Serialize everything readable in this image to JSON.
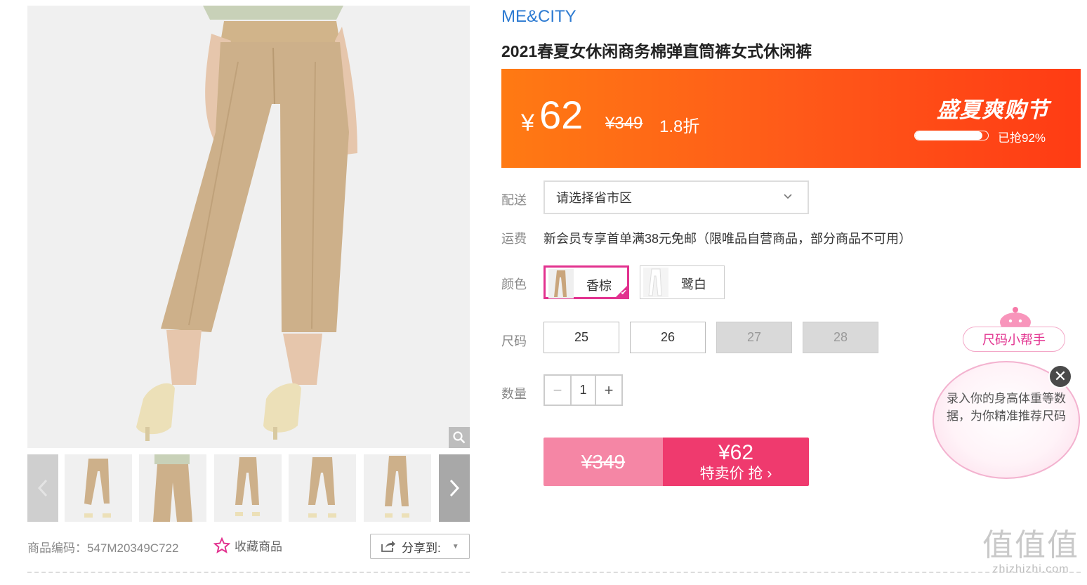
{
  "product": {
    "brand": "ME&CITY",
    "title": "2021春夏女休闲商务棉弹直筒裤女式休闲裤",
    "code_label": "商品编码：547M20349C722",
    "favorite_label": "收藏商品",
    "share_label": "分享到:"
  },
  "price": {
    "currency": "¥",
    "current": "62",
    "original": "¥349",
    "discount": "1.8折",
    "event_name": "盛夏爽购节",
    "progress_text": "已抢92%",
    "progress_percent": 92
  },
  "delivery": {
    "label": "配送",
    "placeholder": "请选择省市区"
  },
  "shipping": {
    "label": "运费",
    "text": "新会员专享首单满38元免邮（限唯品自营商品，部分商品不可用）"
  },
  "color": {
    "label": "颜色",
    "options": [
      {
        "name": "香棕",
        "selected": true,
        "swatch": "#c9a57c"
      },
      {
        "name": "鹭白",
        "selected": false,
        "swatch": "#f0f0f0"
      }
    ]
  },
  "size": {
    "label": "尺码",
    "options": [
      {
        "value": "25",
        "available": true
      },
      {
        "value": "26",
        "available": true
      },
      {
        "value": "27",
        "available": false
      },
      {
        "value": "28",
        "available": false
      }
    ]
  },
  "quantity": {
    "label": "数量",
    "value": "1",
    "minus": "−",
    "plus": "+"
  },
  "buy": {
    "original": "¥349",
    "price": "¥62",
    "cta": "特卖价 抢 ›"
  },
  "size_helper": {
    "button_label": "尺码小帮手",
    "bubble_text": "录入你的身高体重等数据，为你精准推荐尺码",
    "close": "✕"
  },
  "watermark": {
    "text": "值值值",
    "domain": "zhizhizhi.com"
  },
  "colors": {
    "brand_blue": "#2d7bd2",
    "banner_orange": "#ff5a19",
    "accent_pink": "#e2328f",
    "buy_pink": "#ef3a6e",
    "buy_light_pink": "#f586a5"
  }
}
